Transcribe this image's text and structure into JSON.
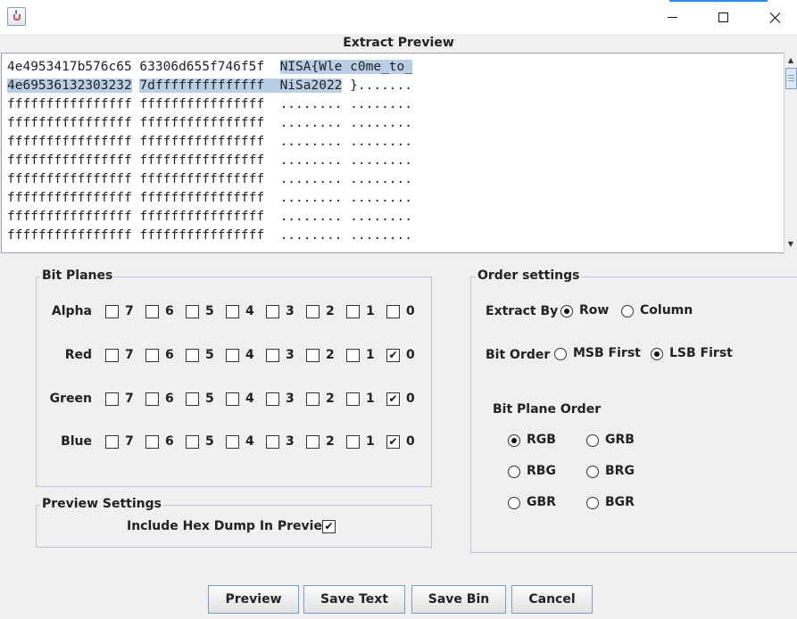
{
  "window": {
    "minimize_icon": "minimize-icon",
    "maximize_icon": "maximize-icon",
    "close_icon": "close-icon"
  },
  "preview": {
    "title": "Extract Preview",
    "lines": [
      {
        "hex1": "4e4953417b576c65",
        "hex2": "63306d655f746f5f",
        "ascii1": "NISA{Wle",
        "ascii2": "c0me_to_"
      },
      {
        "hex1": "4e69536132303232",
        "hex2": "7dffffffffffffff",
        "ascii1": "NiSa2022",
        "ascii2": "}......."
      },
      {
        "hex1": "ffffffffffffffff",
        "hex2": "ffffffffffffffff",
        "ascii1": "........",
        "ascii2": "........"
      },
      {
        "hex1": "ffffffffffffffff",
        "hex2": "ffffffffffffffff",
        "ascii1": "........",
        "ascii2": "........"
      },
      {
        "hex1": "ffffffffffffffff",
        "hex2": "ffffffffffffffff",
        "ascii1": "........",
        "ascii2": "........"
      },
      {
        "hex1": "ffffffffffffffff",
        "hex2": "ffffffffffffffff",
        "ascii1": "........",
        "ascii2": "........"
      },
      {
        "hex1": "ffffffffffffffff",
        "hex2": "ffffffffffffffff",
        "ascii1": "........",
        "ascii2": "........"
      },
      {
        "hex1": "ffffffffffffffff",
        "hex2": "ffffffffffffffff",
        "ascii1": "........",
        "ascii2": "........"
      },
      {
        "hex1": "ffffffffffffffff",
        "hex2": "ffffffffffffffff",
        "ascii1": "........",
        "ascii2": "........"
      },
      {
        "hex1": "ffffffffffffffff",
        "hex2": "ffffffffffffffff",
        "ascii1": "........",
        "ascii2": "........"
      }
    ]
  },
  "bit_planes": {
    "title": "Bit Planes",
    "bits": [
      "7",
      "6",
      "5",
      "4",
      "3",
      "2",
      "1",
      "0"
    ],
    "rows": [
      {
        "label": "Alpha",
        "checked": [
          false,
          false,
          false,
          false,
          false,
          false,
          false,
          false
        ]
      },
      {
        "label": "Red",
        "checked": [
          false,
          false,
          false,
          false,
          false,
          false,
          false,
          true
        ]
      },
      {
        "label": "Green",
        "checked": [
          false,
          false,
          false,
          false,
          false,
          false,
          false,
          true
        ]
      },
      {
        "label": "Blue",
        "checked": [
          false,
          false,
          false,
          false,
          false,
          false,
          false,
          true
        ]
      }
    ]
  },
  "preview_settings": {
    "title": "Preview Settings",
    "include_hex_label": "Include Hex Dump In Preview",
    "include_hex_checked": true
  },
  "order_settings": {
    "title": "Order settings",
    "extract_by_label": "Extract By",
    "extract_by_options": [
      "Row",
      "Column"
    ],
    "extract_by_selected": "Row",
    "bit_order_label": "Bit Order",
    "bit_order_options": [
      "MSB First",
      "LSB First"
    ],
    "bit_order_selected": "LSB First",
    "plane_order_label": "Bit Plane Order",
    "plane_order_options": [
      "RGB",
      "GRB",
      "RBG",
      "BRG",
      "GBR",
      "BGR"
    ],
    "plane_order_selected": "RGB"
  },
  "buttons": {
    "preview": "Preview",
    "save_text": "Save Text",
    "save_bin": "Save Bin",
    "cancel": "Cancel"
  },
  "colors": {
    "selection": "#b8cfe5",
    "group_border": "#b9c6d4",
    "button_border": "#7a9cc4"
  }
}
